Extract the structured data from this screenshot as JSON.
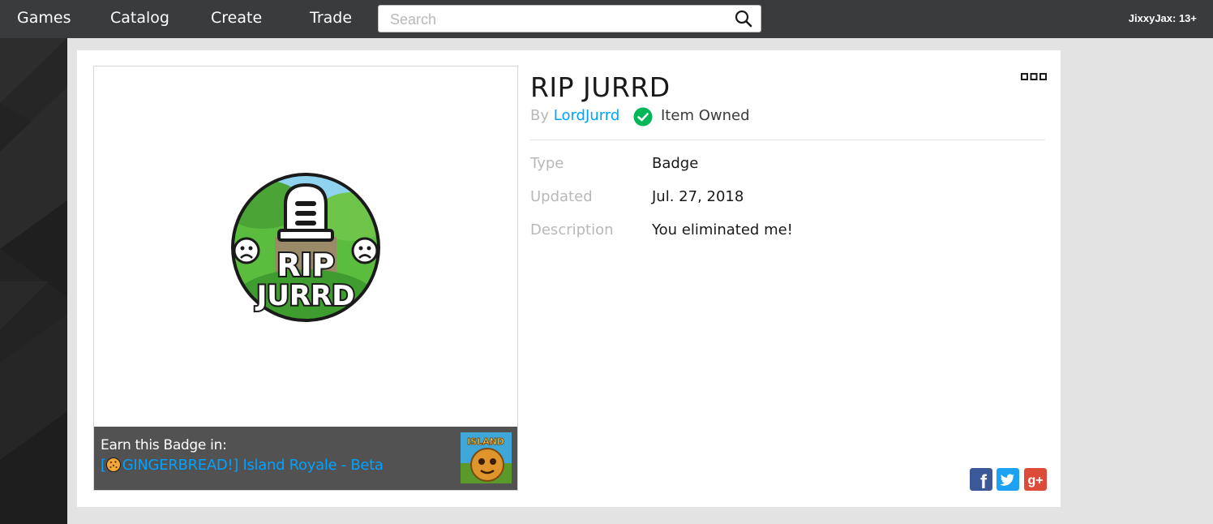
{
  "nav": {
    "items": [
      {
        "label": "Games"
      },
      {
        "label": "Catalog"
      },
      {
        "label": "Create"
      },
      {
        "label": "Trade"
      }
    ],
    "search_placeholder": "Search",
    "user": "JixxyJax: 13+"
  },
  "item": {
    "title": "RIP JURRD",
    "by_prefix": "By",
    "creator": "LordJurrd",
    "owned_label": "Item Owned",
    "badge_text_line1": "RIP",
    "badge_text_line2": "JURRD",
    "fields": [
      {
        "label": "Type",
        "value": "Badge"
      },
      {
        "label": "Updated",
        "value": "Jul. 27, 2018"
      },
      {
        "label": "Description",
        "value": "You eliminated me!"
      }
    ]
  },
  "earn": {
    "label": "Earn this Badge in:",
    "game_prefix": "[",
    "game_name": "GINGERBREAD!] Island Royale - Beta",
    "thumb_text": "ISLAND"
  },
  "share": {
    "facebook_glyph": "f",
    "gplus_glyph": "g+"
  },
  "colors": {
    "nav_bg": "#393b3d",
    "link": "#00a2ff",
    "owned_check": "#02b757",
    "facebook": "#3b5998",
    "twitter": "#1da1f2",
    "gplus": "#dd4b39"
  }
}
